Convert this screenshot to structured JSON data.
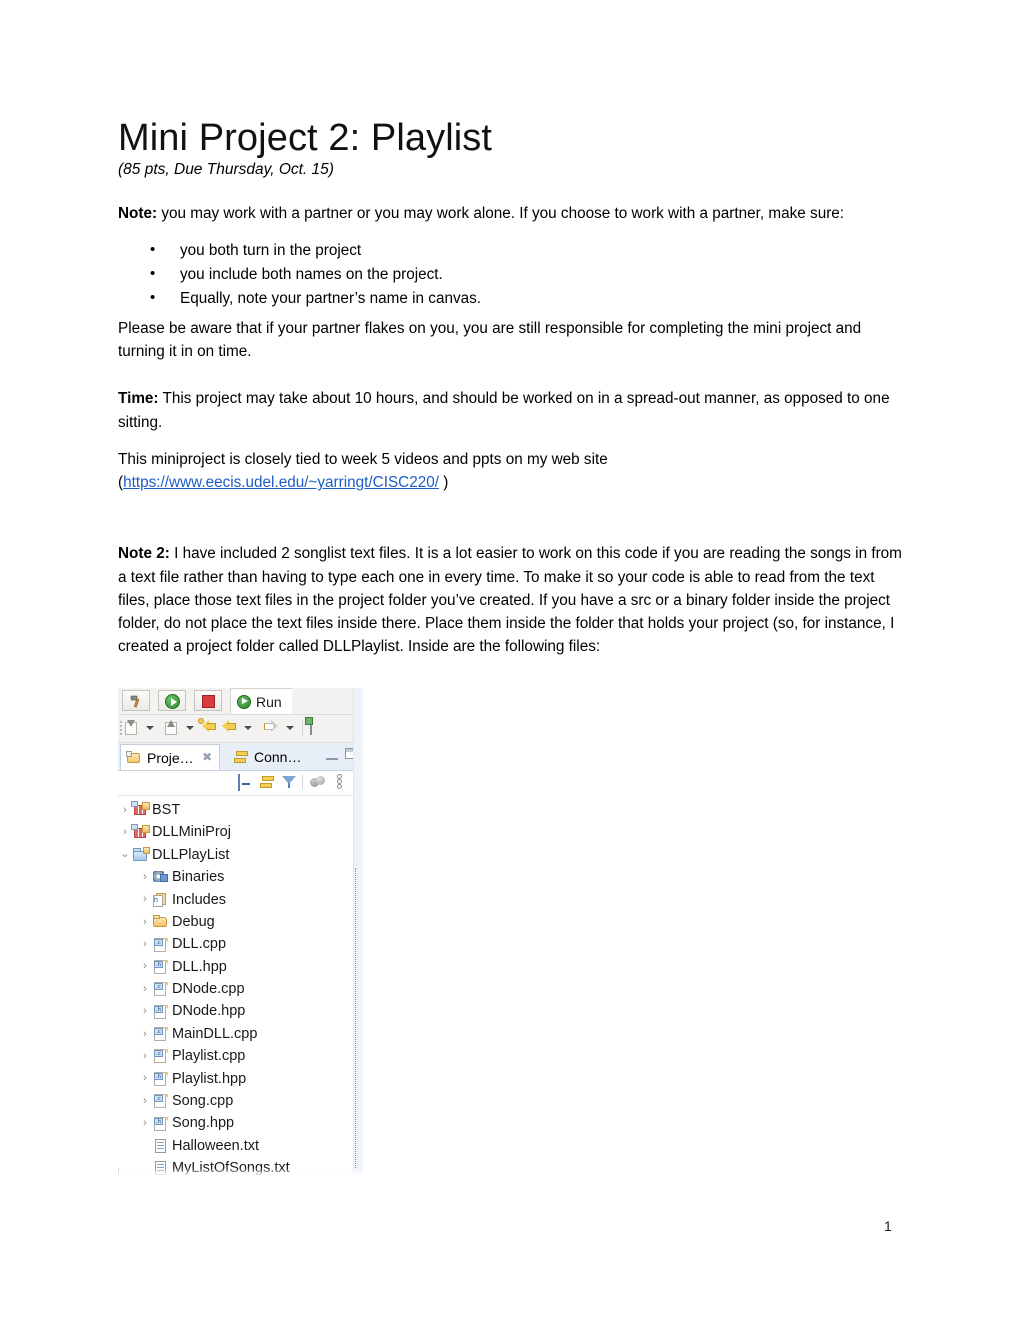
{
  "document": {
    "title": "Mini Project 2: Playlist",
    "subtitle": "(85 pts, Due Thursday, Oct. 15)",
    "page_number": "1",
    "note1": {
      "lead": "Note:",
      "text": " you may work with a partner or you may work alone.  If you choose to work with a partner, make sure:",
      "bullets": [
        "you both turn in the project",
        "you include both names on the project.",
        "Equally, note your partner’s name in canvas."
      ],
      "after": "Please be aware that if your partner flakes on you, you are still responsible for completing the mini project  and turning it in on time."
    },
    "time": {
      "lead": "Time:",
      "text": " This project may take about 10 hours, and should be worked on in a spread-out manner, as opposed to one sitting."
    },
    "website": {
      "text_before": "This miniproject is closely tied to week 5 videos and ppts on my web site",
      "paren_open": "(",
      "link_text": "https://www.eecis.udel.edu/~yarringt/CISC220/",
      "paren_close": " )"
    },
    "note2": {
      "lead": "Note 2:",
      "text": " I have included 2 songlist text files.  It is a lot easier to work on this code if you are reading the songs in from a text file rather than having to type each one in every time.  To make it so your code is able to read from the text files, place those text files in the project folder you’ve created.  If you have a src or a binary folder inside the project folder, do not place the text files inside there.  Place them inside the folder that holds your project (so, for instance, I created a project folder called DLLPlaylist.  Inside are the following files:"
    }
  },
  "screenshot": {
    "toolbar": {
      "buttons": [
        "hammer-icon",
        "run-icon",
        "stop-icon"
      ],
      "run_tab_label": "Run",
      "debug_icons": [
        "step-into-icon",
        "step-return-icon",
        "back-arrow-icon",
        "forward-arrow-icon",
        "new-window-icon"
      ]
    },
    "tabs": [
      {
        "label": "Proje…",
        "active": true,
        "icon": "project-explorer-icon",
        "closable": true
      },
      {
        "label": "Conn…",
        "active": false,
        "icon": "connections-icon",
        "closable": false
      }
    ],
    "window_buttons": [
      "minimize-icon",
      "maximize-icon"
    ],
    "view_toolbar_icons": [
      "collapse-all-icon",
      "link-with-editor-icon",
      "filter-icon",
      "spheres-icon",
      "view-menu-icon"
    ],
    "tree": [
      {
        "label": "BST",
        "level": 1,
        "arrow": "›",
        "icon": "cpp-project-closed-icon"
      },
      {
        "label": "DLLMiniProj",
        "level": 1,
        "arrow": "›",
        "icon": "cpp-project-closed-icon"
      },
      {
        "label": "DLLPlayList",
        "level": 1,
        "arrow": "⌄",
        "icon": "cpp-project-open-icon"
      },
      {
        "label": "Binaries",
        "level": 2,
        "arrow": "›",
        "icon": "binaries-icon"
      },
      {
        "label": "Includes",
        "level": 2,
        "arrow": "›",
        "icon": "includes-icon"
      },
      {
        "label": "Debug",
        "level": 2,
        "arrow": "›",
        "icon": "folder-icon"
      },
      {
        "label": "DLL.cpp",
        "level": 2,
        "arrow": "›",
        "icon": "cpp-file-icon",
        "ext": ".c"
      },
      {
        "label": "DLL.hpp",
        "level": 2,
        "arrow": "›",
        "icon": "hpp-file-icon",
        "ext": ".h"
      },
      {
        "label": "DNode.cpp",
        "level": 2,
        "arrow": "›",
        "icon": "cpp-file-icon",
        "ext": ".c"
      },
      {
        "label": "DNode.hpp",
        "level": 2,
        "arrow": "›",
        "icon": "hpp-file-icon",
        "ext": ".h"
      },
      {
        "label": "MainDLL.cpp",
        "level": 2,
        "arrow": "›",
        "icon": "cpp-file-icon",
        "ext": ".c"
      },
      {
        "label": "Playlist.cpp",
        "level": 2,
        "arrow": "›",
        "icon": "cpp-file-icon",
        "ext": ".c"
      },
      {
        "label": "Playlist.hpp",
        "level": 2,
        "arrow": "›",
        "icon": "hpp-file-icon",
        "ext": ".h"
      },
      {
        "label": "Song.cpp",
        "level": 2,
        "arrow": "›",
        "icon": "cpp-file-icon",
        "ext": ".c"
      },
      {
        "label": "Song.hpp",
        "level": 2,
        "arrow": "›",
        "icon": "hpp-file-icon",
        "ext": ".h"
      },
      {
        "label": "Halloween.txt",
        "level": 2,
        "arrow": "",
        "icon": "text-file-icon"
      },
      {
        "label": "MyListOfSongs.txt",
        "level": 2,
        "arrow": "",
        "icon": "text-file-icon"
      }
    ]
  },
  "colors": {
    "link": "#1c5dc4",
    "tab_active_bg": "#ffffff",
    "tab_bar_bg": "#e7eef7",
    "toolbar_bg": "#f3f2f1"
  }
}
